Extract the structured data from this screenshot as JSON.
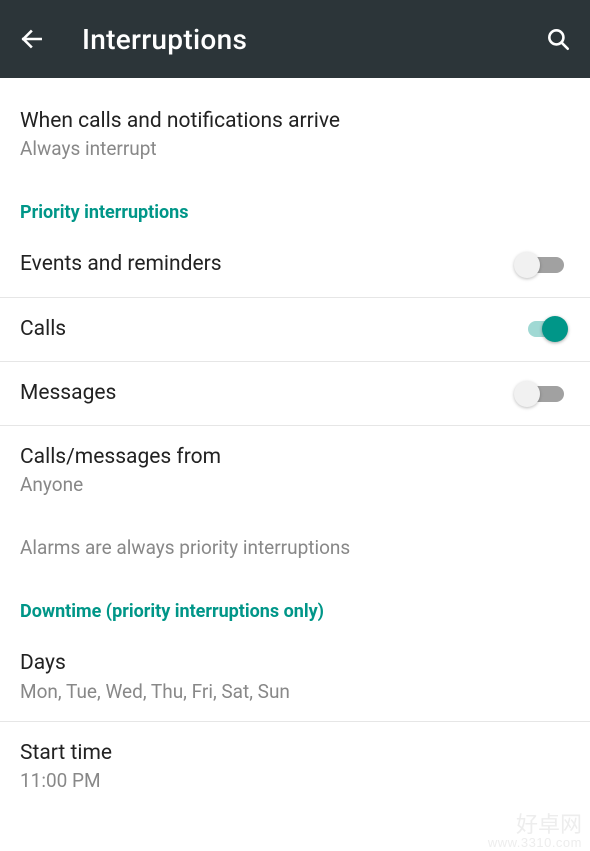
{
  "appbar": {
    "title": "Interruptions"
  },
  "rows": {
    "when": {
      "title": "When calls and notifications arrive",
      "value": "Always interrupt"
    },
    "from": {
      "title": "Calls/messages from",
      "value": "Anyone"
    },
    "days": {
      "title": "Days",
      "value": "Mon, Tue, Wed, Thu, Fri, Sat, Sun"
    },
    "start": {
      "title": "Start time",
      "value": "11:00 PM"
    }
  },
  "sections": {
    "priority": "Priority interruptions",
    "downtime": "Downtime (priority interruptions only)"
  },
  "toggles": {
    "events": {
      "label": "Events and reminders",
      "on": false
    },
    "calls": {
      "label": "Calls",
      "on": true
    },
    "messages": {
      "label": "Messages",
      "on": false
    }
  },
  "note": "Alarms are always priority interruptions",
  "watermark": {
    "line1": "好卓网",
    "line2": "www.3310.com"
  }
}
